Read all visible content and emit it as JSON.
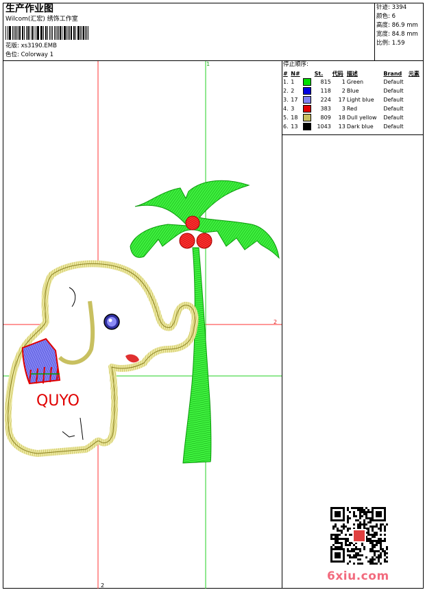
{
  "header": {
    "title": "生产作业图",
    "company": "Wilcom(汇宏) 绣饰工作室",
    "design_label": "花版:",
    "design_value": "xs3190.EMB",
    "colorway_label": "色位:",
    "colorway_value": "Colorway 1"
  },
  "stats": {
    "stitches": "针迹: 3394",
    "colors": "颜色: 6",
    "height": "高度: 86.9 mm",
    "width": "宽度: 84.8 mm",
    "scale": "比例: 1.59"
  },
  "stop_sequence": {
    "title": "停止顺序:",
    "headers": [
      "#",
      "N#",
      "St.",
      "代码",
      "描述",
      "Brand",
      "元素"
    ],
    "rows": [
      {
        "idx": "1.",
        "n": "1",
        "color": "#00e000",
        "st": "815",
        "code": "1",
        "desc": "Green",
        "brand": "Default"
      },
      {
        "idx": "2.",
        "n": "2",
        "color": "#0000e0",
        "st": "118",
        "code": "2",
        "desc": "Blue",
        "brand": "Default"
      },
      {
        "idx": "3.",
        "n": "17",
        "color": "#8080f0",
        "st": "224",
        "code": "17",
        "desc": "Light blue",
        "brand": "Default"
      },
      {
        "idx": "4.",
        "n": "3",
        "color": "#e00000",
        "st": "383",
        "code": "3",
        "desc": "Red",
        "brand": "Default"
      },
      {
        "idx": "5.",
        "n": "18",
        "color": "#c8c060",
        "st": "809",
        "code": "18",
        "desc": "Dull yellow",
        "brand": "Default"
      },
      {
        "idx": "6.",
        "n": "13",
        "color": "#000000",
        "st": "1043",
        "code": "13",
        "desc": "Dark blue",
        "brand": "Default"
      }
    ]
  },
  "canvas": {
    "guide_labels": [
      "1",
      "2",
      "2"
    ],
    "lettering": "QUYO",
    "colors": {
      "guide_red": "#ff0000",
      "guide_green": "#00c000",
      "palm": "#22dd22",
      "elephant": "#d4cc66",
      "saddle": "#6060e0",
      "fringe": "#e01010"
    }
  },
  "footer": {
    "logo_text": "6xiu.com"
  }
}
